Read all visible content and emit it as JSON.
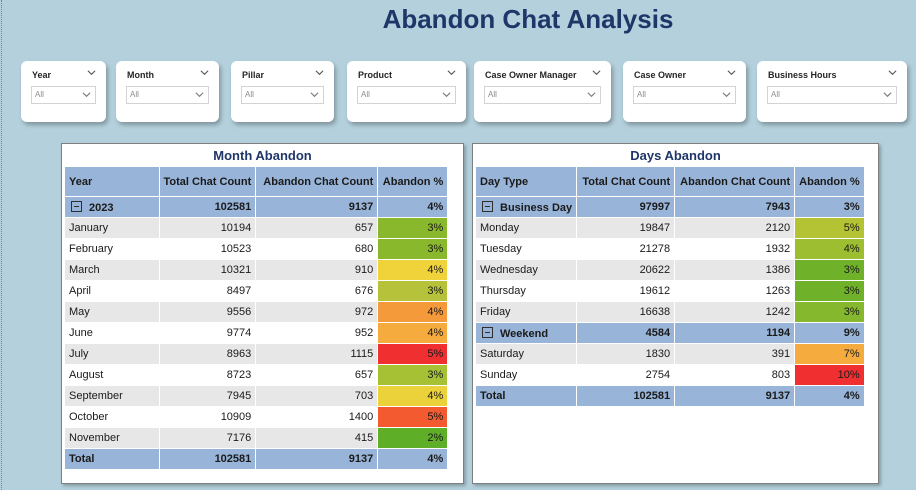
{
  "page_title": "Abandon Chat Analysis",
  "slicers": [
    {
      "label": "Year",
      "value": "All"
    },
    {
      "label": "Month",
      "value": "All"
    },
    {
      "label": "Pillar",
      "value": "All"
    },
    {
      "label": "Product",
      "value": "All"
    },
    {
      "label": "Case Owner Manager",
      "value": "All"
    },
    {
      "label": "Case Owner",
      "value": "All"
    },
    {
      "label": "Business Hours",
      "value": "All"
    }
  ],
  "month_panel": {
    "title": "Month Abandon",
    "headers": [
      "Year",
      "Total Chat Count",
      "Abandon Chat Count",
      "Abandon %"
    ],
    "group": {
      "label": "2023",
      "total": "102581",
      "abandon": "9137",
      "pct": "4%"
    },
    "rows": [
      {
        "label": "January",
        "total": "10194",
        "abandon": "657",
        "pct": "3%",
        "color": "#8ab82c"
      },
      {
        "label": "February",
        "total": "10523",
        "abandon": "680",
        "pct": "3%",
        "color": "#8ab82c"
      },
      {
        "label": "March",
        "total": "10321",
        "abandon": "910",
        "pct": "4%",
        "color": "#f0d23b"
      },
      {
        "label": "April",
        "total": "8497",
        "abandon": "676",
        "pct": "3%",
        "color": "#b6c33a"
      },
      {
        "label": "May",
        "total": "9556",
        "abandon": "972",
        "pct": "4%",
        "color": "#f59a3b"
      },
      {
        "label": "June",
        "total": "9774",
        "abandon": "952",
        "pct": "4%",
        "color": "#f5ab3d"
      },
      {
        "label": "July",
        "total": "8963",
        "abandon": "1115",
        "pct": "5%",
        "color": "#f03030"
      },
      {
        "label": "August",
        "total": "8723",
        "abandon": "657",
        "pct": "3%",
        "color": "#a7c134"
      },
      {
        "label": "September",
        "total": "7945",
        "abandon": "703",
        "pct": "4%",
        "color": "#ecd23a"
      },
      {
        "label": "October",
        "total": "10909",
        "abandon": "1400",
        "pct": "5%",
        "color": "#f35a30"
      },
      {
        "label": "November",
        "total": "7176",
        "abandon": "415",
        "pct": "2%",
        "color": "#5fae27"
      }
    ],
    "total": {
      "label": "Total",
      "total": "102581",
      "abandon": "9137",
      "pct": "4%"
    }
  },
  "days_panel": {
    "title": "Days Abandon",
    "headers": [
      "Day Type",
      "Total Chat Count",
      "Abandon Chat Count",
      "Abandon %"
    ],
    "groups": [
      {
        "label": "Business Day",
        "total": "97997",
        "abandon": "7943",
        "pct": "3%",
        "rows": [
          {
            "label": "Monday",
            "total": "19847",
            "abandon": "2120",
            "pct": "5%",
            "color": "#b3c333"
          },
          {
            "label": "Tuesday",
            "total": "21278",
            "abandon": "1932",
            "pct": "4%",
            "color": "#9cbe30"
          },
          {
            "label": "Wednesday",
            "total": "20622",
            "abandon": "1386",
            "pct": "3%",
            "color": "#6fb22a"
          },
          {
            "label": "Thursday",
            "total": "19612",
            "abandon": "1263",
            "pct": "3%",
            "color": "#6fb22a"
          },
          {
            "label": "Friday",
            "total": "16638",
            "abandon": "1242",
            "pct": "3%",
            "color": "#86b82d"
          }
        ]
      },
      {
        "label": "Weekend",
        "total": "4584",
        "abandon": "1194",
        "pct": "9%",
        "rows": [
          {
            "label": "Saturday",
            "total": "1830",
            "abandon": "391",
            "pct": "7%",
            "color": "#f5ab3d"
          },
          {
            "label": "Sunday",
            "total": "2754",
            "abandon": "803",
            "pct": "10%",
            "color": "#f03030"
          }
        ]
      }
    ],
    "total": {
      "label": "Total",
      "total": "102581",
      "abandon": "9137",
      "pct": "4%"
    }
  }
}
